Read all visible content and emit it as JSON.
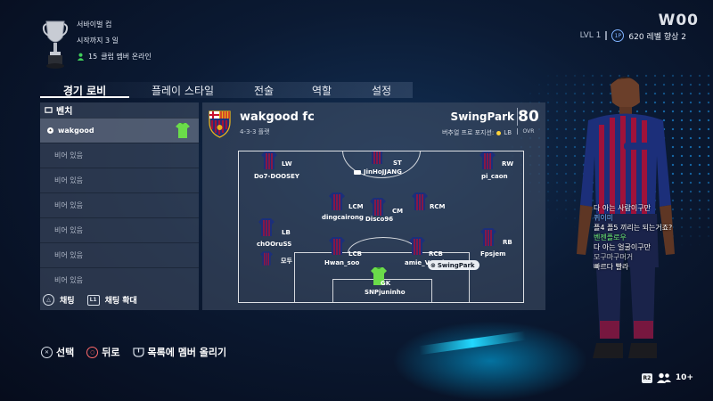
{
  "club": {
    "trophy_title": "서바이벌 컵",
    "start_info": "시작까지 3 일",
    "online_count": "15",
    "online_label": "클럽 멤버 온라인"
  },
  "profile": {
    "tag": "W00",
    "level": "LVL 1",
    "tp_badge": "1P",
    "level_progress": "620 레벨 향상 2"
  },
  "tabs": [
    {
      "label": "경기 로비",
      "active": true
    },
    {
      "label": "플레이 스타일",
      "active": false
    },
    {
      "label": "전술",
      "active": false
    },
    {
      "label": "역할",
      "active": false
    },
    {
      "label": "설정",
      "active": false
    }
  ],
  "bench": {
    "title": "벤치",
    "items": [
      {
        "label": "wakgood",
        "filled": true
      },
      {
        "label": "비어 있음",
        "filled": false
      },
      {
        "label": "비어 있음",
        "filled": false
      },
      {
        "label": "비어 있음",
        "filled": false
      },
      {
        "label": "비어 있음",
        "filled": false
      },
      {
        "label": "비어 있음",
        "filled": false
      },
      {
        "label": "비어 있음",
        "filled": false
      }
    ],
    "chat_label": "채팅",
    "chat_expand_label": "채팅 확대",
    "chat_key": "L1"
  },
  "team": {
    "name": "wakgood fc",
    "formation": "4-3-3 플랫",
    "owner": "SwingPark",
    "position_line": "버추얼 프로 포지션:",
    "position": "LB",
    "ovr": "80",
    "ovr_label": "OVR",
    "players": [
      {
        "pos": "LW",
        "name": "Do7-DOOSEY"
      },
      {
        "pos": "ST",
        "name": "JinHoJJANG"
      },
      {
        "pos": "RW",
        "name": "pi_caon"
      },
      {
        "pos": "LCM",
        "name": "dingcairong"
      },
      {
        "pos": "CM",
        "name": "Disco96"
      },
      {
        "pos": "RCM",
        "name": ""
      },
      {
        "pos": "LB",
        "name": "chOOruSS"
      },
      {
        "pos": "",
        "name": "모두"
      },
      {
        "pos": "LCB",
        "name": "Hwan_soo"
      },
      {
        "pos": "RCB",
        "name": "amie_Varrdy"
      },
      {
        "pos": "RB",
        "name": "Fpsjem"
      },
      {
        "pos": "GK",
        "name": "SNPjuninho"
      }
    ],
    "swing_tag": "SwingPark"
  },
  "chat": [
    {
      "text": "다 아는 사람이구만",
      "type": "msg"
    },
    {
      "text": "퀴이미",
      "type": "user-blue"
    },
    {
      "text": "플4 플5 끼리는 되는거죠?",
      "type": "msg"
    },
    {
      "text": "벤젠플로우",
      "type": "user-green"
    },
    {
      "text": "다 아는 얼굴이구만",
      "type": "msg"
    },
    {
      "text": "모구마구머거",
      "type": "user-dim"
    },
    {
      "text": "빠르다 빨라",
      "type": "msg"
    }
  ],
  "controls": {
    "select": "선택",
    "back": "뒤로",
    "post": "목록에 멤버 올리기",
    "r2": "R2",
    "members": "10+"
  },
  "colors": {
    "background": "#0b1a33",
    "panel": "#46526a",
    "barca_blue": "#1c2f7a",
    "barca_red": "#a0123a",
    "gk_kit": "#6bdc4a",
    "position_dot": "#ffd33a",
    "chat_blue": "#77b8ff",
    "chat_green": "#6ef07a"
  }
}
